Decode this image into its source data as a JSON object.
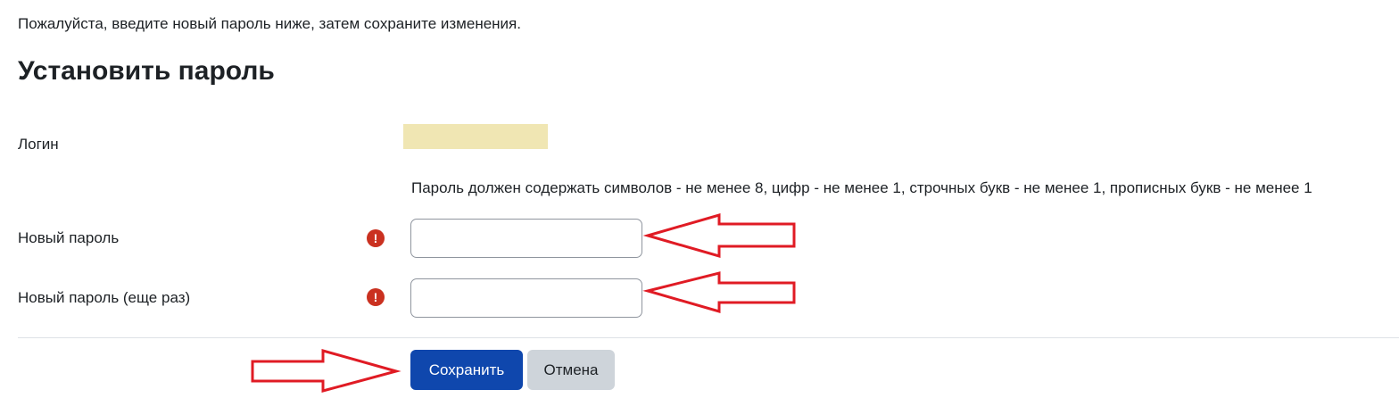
{
  "intro_text": "Пожалуйста, введите новый пароль ниже, затем сохраните изменения.",
  "page_title": "Установить пароль",
  "login": {
    "label": "Логин",
    "value": ""
  },
  "password_policy": "Пароль должен содержать символов - не менее 8, цифр - не менее 1, строчных букв - не менее 1, прописных букв - не менее 1",
  "new_password": {
    "label": "Новый пароль",
    "value": "",
    "required_icon": "exclamation-circle-icon"
  },
  "new_password_repeat": {
    "label": "Новый пароль (еще раз)",
    "value": "",
    "required_icon": "exclamation-circle-icon"
  },
  "buttons": {
    "save": "Сохранить",
    "cancel": "Отмена"
  },
  "colors": {
    "primary_button": "#0f47ad",
    "secondary_button": "#ced4da",
    "required_icon": "#ca3120",
    "annotation_arrow": "#e01b24",
    "login_highlight": "#f0e6b3"
  }
}
